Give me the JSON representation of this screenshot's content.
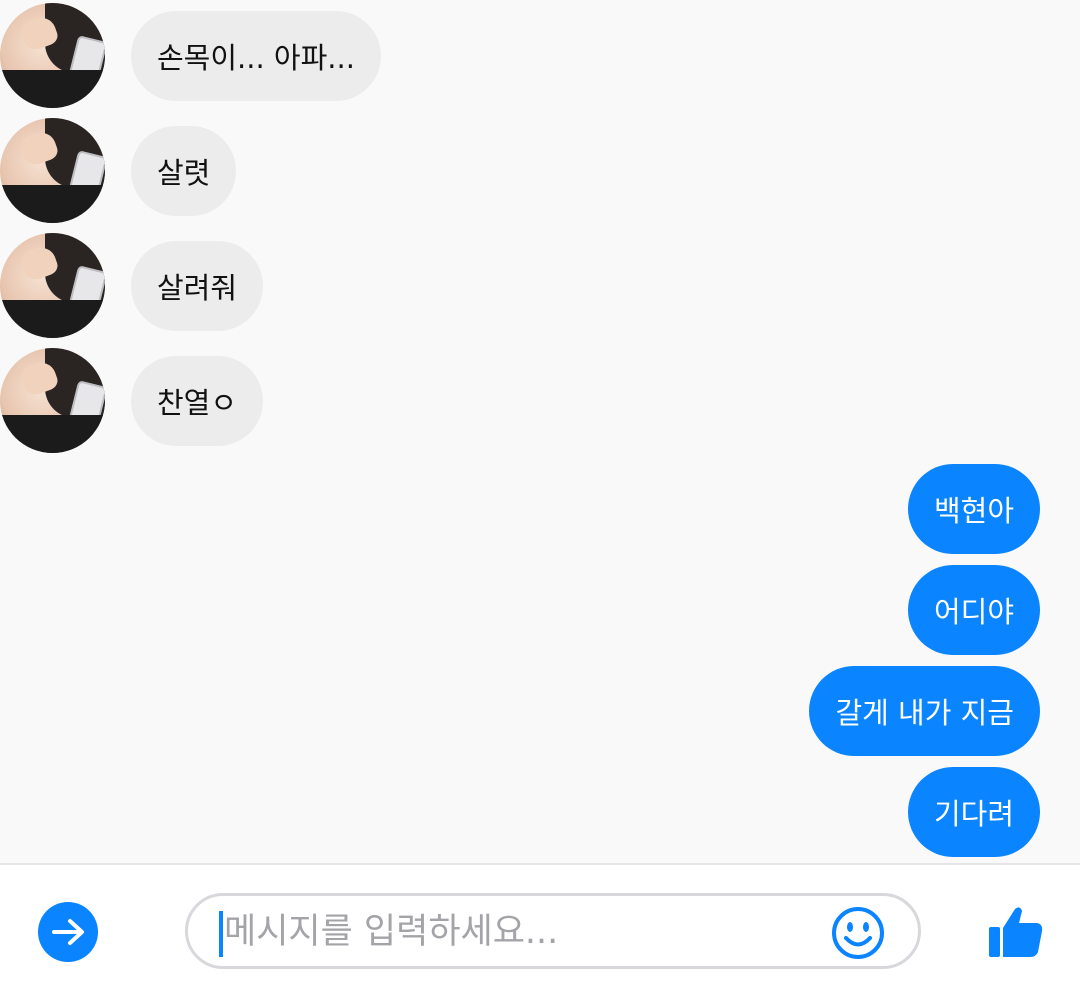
{
  "incoming_messages": [
    {
      "text": "손목이... 아파..."
    },
    {
      "text": "살렷"
    },
    {
      "text": "살려줘"
    },
    {
      "text": "찬열ㅇ"
    }
  ],
  "outgoing_messages": [
    {
      "text": "백현아"
    },
    {
      "text": "어디야"
    },
    {
      "text": "갈게 내가 지금"
    },
    {
      "text": "기다려"
    }
  ],
  "composer": {
    "placeholder": "메시지를 입력하세요...",
    "value": "",
    "left_icon": "arrow-right-icon",
    "emoji_icon": "smiley-icon",
    "send_icon": "thumbs-up-icon"
  },
  "colors": {
    "accent": "#0a84ff",
    "incoming_bubble": "#ececed",
    "background": "#f9f9fa"
  }
}
